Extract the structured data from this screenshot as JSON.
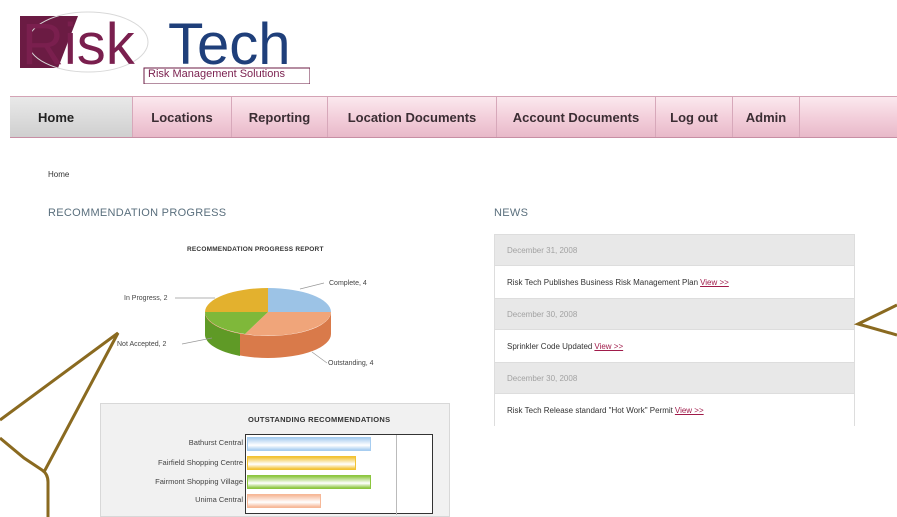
{
  "brand": {
    "name_part1": "Risk",
    "name_part2": "Tech",
    "tagline": "Risk Management Solutions"
  },
  "nav": {
    "items": [
      {
        "label": "Home",
        "active": true
      },
      {
        "label": "Locations"
      },
      {
        "label": "Reporting"
      },
      {
        "label": "Location Documents"
      },
      {
        "label": "Account Documents"
      },
      {
        "label": "Log out"
      },
      {
        "label": "Admin"
      }
    ]
  },
  "breadcrumb": "Home",
  "progress": {
    "heading": "RECOMMENDATION PROGRESS",
    "pie": {
      "title": "RECOMMENDATION PROGRESS REPORT",
      "slices": [
        {
          "label": "Complete, 4",
          "value": 4,
          "color": "#9cc3e6"
        },
        {
          "label": "Outstanding, 4",
          "value": 4,
          "color": "#f0a57a"
        },
        {
          "label": "Not Accepted, 2",
          "value": 2,
          "color": "#7fb83a"
        },
        {
          "label": "In Progress, 2",
          "value": 2,
          "color": "#e3b12e"
        }
      ]
    },
    "bar": {
      "title": "OUTSTANDING RECOMMENDATIONS",
      "categories": [
        {
          "name": "Bathurst Central",
          "value": 1.0,
          "color": "#a7cdf0"
        },
        {
          "name": "Fairfield Shopping Centre",
          "value": 0.88,
          "color": "#f2c233"
        },
        {
          "name": "Fairmont Shopping Village",
          "value": 1.0,
          "color": "#8cc63f"
        },
        {
          "name": "Unima Central",
          "value": 0.6,
          "color": "#f6b898"
        }
      ]
    }
  },
  "news": {
    "heading": "NEWS",
    "items": [
      {
        "date": "December 31, 2008",
        "text": "Risk Tech Publishes Business Risk Management Plan",
        "link": "View >>"
      },
      {
        "date": "December 30, 2008",
        "text": "Sprinkler Code Updated",
        "link": "View >>"
      },
      {
        "date": "December 30, 2008",
        "text": "Risk Tech Release standard \"Hot Work\" Permit",
        "link": "View >>"
      }
    ]
  },
  "colors": {
    "brand_maroon": "#7a1f4e",
    "brand_blue": "#1f3f7a",
    "callout_border": "#8a6a20"
  }
}
